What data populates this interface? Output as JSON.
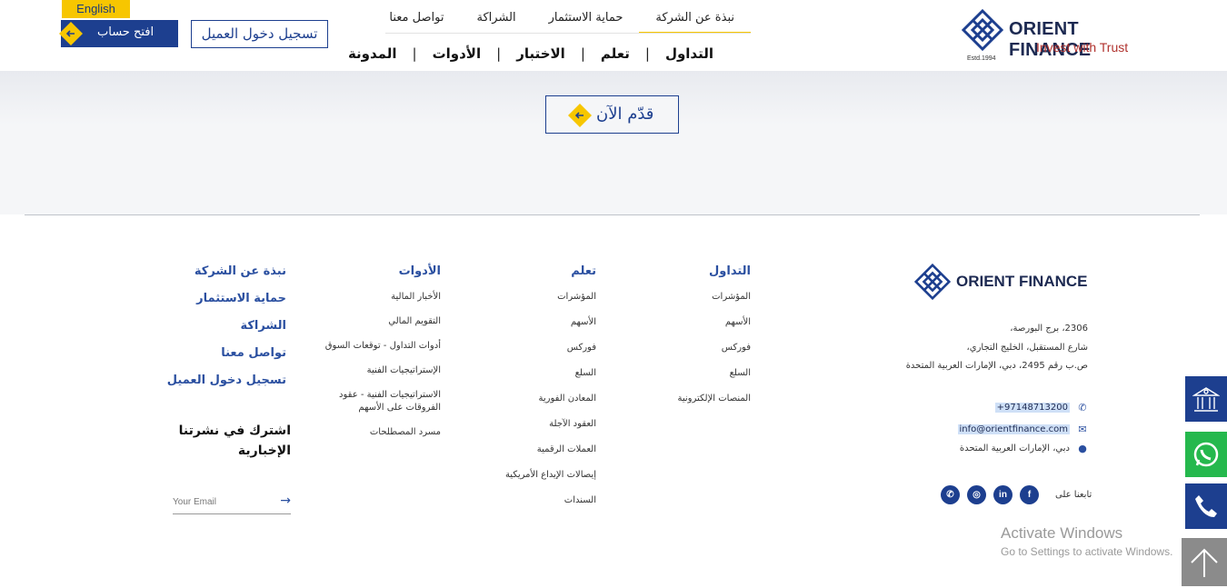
{
  "header": {
    "lang": "English",
    "open_account": "افتح حساب",
    "client_login": "تسجيل دخول العميل",
    "top_nav": [
      "نبذة عن الشركة",
      "حماية الاستثمار",
      "الشراكة",
      "تواصل معنا"
    ],
    "main_nav": [
      "التداول",
      "تعلم",
      "الاختبار",
      "الأدوات",
      "المدونة"
    ],
    "logo": {
      "brand": "ORIENT FINANCE",
      "tagline": "Invest with Trust",
      "est": "Estd.1994"
    }
  },
  "hero": {
    "apply_label": "قدّم الآن"
  },
  "footer": {
    "trading": {
      "title": "التداول",
      "links": [
        "المؤشرات",
        "الأسهم",
        "فوركس",
        "السلع",
        "المنصات الإلكترونية"
      ]
    },
    "learn": {
      "title": "تعلم",
      "links": [
        "المؤشرات",
        "الأسهم",
        "فوركس",
        "السلع",
        "المعادن الفورية",
        "العقود الآجلة",
        "العملات الرقمية",
        "إيصالات الإيداع الأمريكية",
        "السندات"
      ]
    },
    "tools": {
      "title": "الأدوات",
      "links": [
        "الأخبار المالية",
        "التقويم المالي",
        "أدوات التداول - توقعات السوق",
        "الإستراتيجيات الفنية",
        "الاستراتيجيات الفنية - عقود الفروقات على الأسهم",
        "مسرد المصطلحات"
      ]
    },
    "company": [
      "نبذة عن الشركة",
      "حماية الاستثمار",
      "الشراكة",
      "تواصل معنا",
      "تسجيل دخول العميل"
    ],
    "newsletter": {
      "title": "اشترك في نشرتنا الإخبارية",
      "placeholder": "Your Email"
    },
    "logo_brand": "ORIENT FINANCE",
    "address_lines": [
      "2306، برج البورصة،",
      "شارع المستقبل، الخليج التجاري،",
      "ص.ب رقم 2495، دبي، الإمارات العربية المتحدة"
    ],
    "phone": "+97148713200",
    "email": "info@orientfinance.com",
    "location": "دبي، الإمارات العربية المتحدة",
    "follow_us": "تابعنا على"
  },
  "watermark": {
    "line1": "Activate Windows",
    "line2": "Go to Settings to activate Windows."
  },
  "colors": {
    "brand_blue": "#1d3f8f",
    "accent_yellow": "#f7c600",
    "whatsapp_green": "#25b84d"
  }
}
